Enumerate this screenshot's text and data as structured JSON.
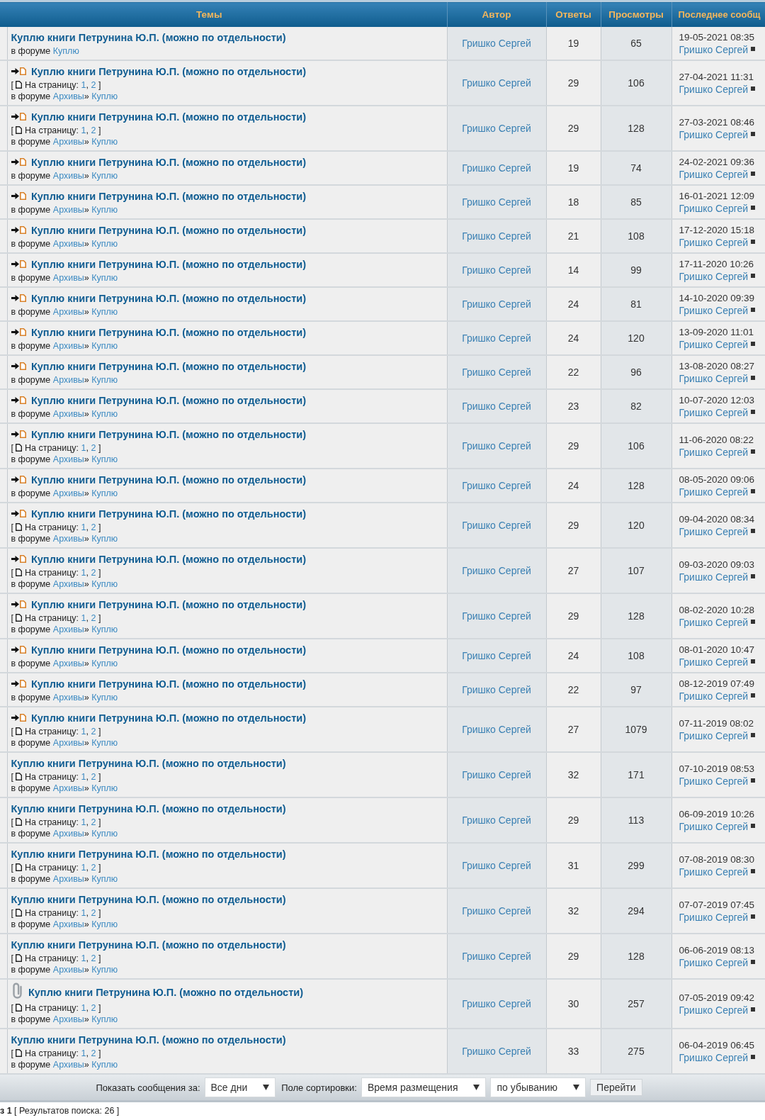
{
  "table": {
    "columns": [
      "Темы",
      "Автор",
      "Ответы",
      "Просмотры",
      "Последнее сообщ"
    ],
    "rows": [
      {
        "kind": "plain",
        "title": "Куплю книги Петрунина Ю.П. (можно по отдельности)",
        "forum": {
          "label": "в форуме",
          "links": [
            "Куплю"
          ]
        },
        "author": "Гришко Сергей",
        "replies": "19",
        "views": "65",
        "last_post": {
          "time": "19-05-2021 08:35",
          "author": "Гришко Сергей"
        }
      },
      {
        "kind": "moved",
        "title": "Куплю книги Петрунина Ю.П. (можно по отдельности)",
        "pages": {
          "open": "[",
          "label": "На страницу:",
          "links": [
            "1",
            "2"
          ],
          "separator": ",",
          "close": "]"
        },
        "forum": {
          "label": "в форуме",
          "links": [
            "Архивы",
            "Куплю"
          ],
          "separator": "»"
        },
        "author": "Гришко Сергей",
        "replies": "29",
        "views": "106",
        "last_post": {
          "time": "27-04-2021 11:31",
          "author": "Гришко Сергей"
        }
      },
      {
        "kind": "moved",
        "title": "Куплю книги Петрунина Ю.П. (можно по отдельности)",
        "pages": {
          "open": "[",
          "label": "На страницу:",
          "links": [
            "1",
            "2"
          ],
          "separator": ",",
          "close": "]"
        },
        "forum": {
          "label": "в форуме",
          "links": [
            "Архивы",
            "Куплю"
          ],
          "separator": "»"
        },
        "author": "Гришко Сергей",
        "replies": "29",
        "views": "128",
        "last_post": {
          "time": "27-03-2021 08:46",
          "author": "Гришко Сергей"
        }
      },
      {
        "kind": "moved",
        "title": "Куплю книги Петрунина Ю.П. (можно по отдельности)",
        "forum": {
          "label": "в форуме",
          "links": [
            "Архивы",
            "Куплю"
          ],
          "separator": "»"
        },
        "author": "Гришко Сергей",
        "replies": "19",
        "views": "74",
        "last_post": {
          "time": "24-02-2021 09:36",
          "author": "Гришко Сергей"
        }
      },
      {
        "kind": "moved",
        "title": "Куплю книги Петрунина Ю.П. (можно по отдельности)",
        "forum": {
          "label": "в форуме",
          "links": [
            "Архивы",
            "Куплю"
          ],
          "separator": "»"
        },
        "author": "Гришко Сергей",
        "replies": "18",
        "views": "85",
        "last_post": {
          "time": "16-01-2021 12:09",
          "author": "Гришко Сергей"
        }
      },
      {
        "kind": "moved",
        "title": "Куплю книги Петрунина Ю.П. (можно по отдельности)",
        "forum": {
          "label": "в форуме",
          "links": [
            "Архивы",
            "Куплю"
          ],
          "separator": "»"
        },
        "author": "Гришко Сергей",
        "replies": "21",
        "views": "108",
        "last_post": {
          "time": "17-12-2020 15:18",
          "author": "Гришко Сергей"
        }
      },
      {
        "kind": "moved",
        "title": "Куплю книги Петрунина Ю.П. (можно по отдельности)",
        "forum": {
          "label": "в форуме",
          "links": [
            "Архивы",
            "Куплю"
          ],
          "separator": "»"
        },
        "author": "Гришко Сергей",
        "replies": "14",
        "views": "99",
        "last_post": {
          "time": "17-11-2020 10:26",
          "author": "Гришко Сергей"
        }
      },
      {
        "kind": "moved",
        "title": "Куплю книги Петрунина Ю.П. (можно по отдельности)",
        "forum": {
          "label": "в форуме",
          "links": [
            "Архивы",
            "Куплю"
          ],
          "separator": "»"
        },
        "author": "Гришко Сергей",
        "replies": "24",
        "views": "81",
        "last_post": {
          "time": "14-10-2020 09:39",
          "author": "Гришко Сергей"
        }
      },
      {
        "kind": "moved",
        "title": "Куплю книги Петрунина Ю.П. (можно по отдельности)",
        "forum": {
          "label": "в форуме",
          "links": [
            "Архивы",
            "Куплю"
          ],
          "separator": "»"
        },
        "author": "Гришко Сергей",
        "replies": "24",
        "views": "120",
        "last_post": {
          "time": "13-09-2020 11:01",
          "author": "Гришко Сергей"
        }
      },
      {
        "kind": "moved",
        "title": "Куплю книги Петрунина Ю.П. (можно по отдельности)",
        "forum": {
          "label": "в форуме",
          "links": [
            "Архивы",
            "Куплю"
          ],
          "separator": "»"
        },
        "author": "Гришко Сергей",
        "replies": "22",
        "views": "96",
        "last_post": {
          "time": "13-08-2020 08:27",
          "author": "Гришко Сергей"
        }
      },
      {
        "kind": "moved",
        "title": "Куплю книги Петрунина Ю.П. (можно по отдельности)",
        "forum": {
          "label": "в форуме",
          "links": [
            "Архивы",
            "Куплю"
          ],
          "separator": "»"
        },
        "author": "Гришко Сергей",
        "replies": "23",
        "views": "82",
        "last_post": {
          "time": "10-07-2020 12:03",
          "author": "Гришко Сергей"
        }
      },
      {
        "kind": "moved",
        "title": "Куплю книги Петрунина Ю.П. (можно по отдельности)",
        "pages": {
          "open": "[",
          "label": "На страницу:",
          "links": [
            "1",
            "2"
          ],
          "separator": ",",
          "close": "]"
        },
        "forum": {
          "label": "в форуме",
          "links": [
            "Архивы",
            "Куплю"
          ],
          "separator": "»"
        },
        "author": "Гришко Сергей",
        "replies": "29",
        "views": "106",
        "last_post": {
          "time": "11-06-2020 08:22",
          "author": "Гришко Сергей"
        }
      },
      {
        "kind": "moved",
        "title": "Куплю книги Петрунина Ю.П. (можно по отдельности)",
        "forum": {
          "label": "в форуме",
          "links": [
            "Архивы",
            "Куплю"
          ],
          "separator": "»"
        },
        "author": "Гришко Сергей",
        "replies": "24",
        "views": "128",
        "last_post": {
          "time": "08-05-2020 09:06",
          "author": "Гришко Сергей"
        }
      },
      {
        "kind": "moved",
        "title": "Куплю книги Петрунина Ю.П. (можно по отдельности)",
        "pages": {
          "open": "[",
          "label": "На страницу:",
          "links": [
            "1",
            "2"
          ],
          "separator": ",",
          "close": "]"
        },
        "forum": {
          "label": "в форуме",
          "links": [
            "Архивы",
            "Куплю"
          ],
          "separator": "»"
        },
        "author": "Гришко Сергей",
        "replies": "29",
        "views": "120",
        "last_post": {
          "time": "09-04-2020 08:34",
          "author": "Гришко Сергей"
        }
      },
      {
        "kind": "moved",
        "title": "Куплю книги Петрунина Ю.П. (можно по отдельности)",
        "pages": {
          "open": "[",
          "label": "На страницу:",
          "links": [
            "1",
            "2"
          ],
          "separator": ",",
          "close": "]"
        },
        "forum": {
          "label": "в форуме",
          "links": [
            "Архивы",
            "Куплю"
          ],
          "separator": "»"
        },
        "author": "Гришко Сергей",
        "replies": "27",
        "views": "107",
        "last_post": {
          "time": "09-03-2020 09:03",
          "author": "Гришко Сергей"
        }
      },
      {
        "kind": "moved",
        "title": "Куплю книги Петрунина Ю.П. (можно по отдельности)",
        "pages": {
          "open": "[",
          "label": "На страницу:",
          "links": [
            "1",
            "2"
          ],
          "separator": ",",
          "close": "]"
        },
        "forum": {
          "label": "в форуме",
          "links": [
            "Архивы",
            "Куплю"
          ],
          "separator": "»"
        },
        "author": "Гришко Сергей",
        "replies": "29",
        "views": "128",
        "last_post": {
          "time": "08-02-2020 10:28",
          "author": "Гришко Сергей"
        }
      },
      {
        "kind": "moved",
        "title": "Куплю книги Петрунина Ю.П. (можно по отдельности)",
        "forum": {
          "label": "в форуме",
          "links": [
            "Архивы",
            "Куплю"
          ],
          "separator": "»"
        },
        "author": "Гришко Сергей",
        "replies": "24",
        "views": "108",
        "last_post": {
          "time": "08-01-2020 10:47",
          "author": "Гришко Сергей"
        }
      },
      {
        "kind": "moved",
        "title": "Куплю книги Петрунина Ю.П. (можно по отдельности)",
        "forum": {
          "label": "в форуме",
          "links": [
            "Архивы",
            "Куплю"
          ],
          "separator": "»"
        },
        "author": "Гришко Сергей",
        "replies": "22",
        "views": "97",
        "last_post": {
          "time": "08-12-2019 07:49",
          "author": "Гришко Сергей"
        }
      },
      {
        "kind": "moved",
        "title": "Куплю книги Петрунина Ю.П. (можно по отдельности)",
        "pages": {
          "open": "[",
          "label": "На страницу:",
          "links": [
            "1",
            "2"
          ],
          "separator": ",",
          "close": "]"
        },
        "forum": {
          "label": "в форуме",
          "links": [
            "Архивы",
            "Куплю"
          ],
          "separator": "»"
        },
        "author": "Гришко Сергей",
        "replies": "27",
        "views": "1079",
        "last_post": {
          "time": "07-11-2019 08:02",
          "author": "Гришко Сергей"
        }
      },
      {
        "kind": "plain",
        "title": "Куплю книги Петрунина Ю.П. (можно по отдельности)",
        "pages": {
          "open": "[",
          "label": "На страницу:",
          "links": [
            "1",
            "2"
          ],
          "separator": ",",
          "close": "]"
        },
        "forum": {
          "label": "в форуме",
          "links": [
            "Архивы",
            "Куплю"
          ],
          "separator": "»"
        },
        "author": "Гришко Сергей",
        "replies": "32",
        "views": "171",
        "last_post": {
          "time": "07-10-2019 08:53",
          "author": "Гришко Сергей"
        }
      },
      {
        "kind": "plain",
        "title": "Куплю книги Петрунина Ю.П. (можно по отдельности)",
        "pages": {
          "open": "[",
          "label": "На страницу:",
          "links": [
            "1",
            "2"
          ],
          "separator": ",",
          "close": "]"
        },
        "forum": {
          "label": "в форуме",
          "links": [
            "Архивы",
            "Куплю"
          ],
          "separator": "»"
        },
        "author": "Гришко Сергей",
        "replies": "29",
        "views": "113",
        "last_post": {
          "time": "06-09-2019 10:26",
          "author": "Гришко Сергей"
        }
      },
      {
        "kind": "plain",
        "title": "Куплю книги Петрунина Ю.П. (можно по отдельности)",
        "pages": {
          "open": "[",
          "label": "На страницу:",
          "links": [
            "1",
            "2"
          ],
          "separator": ",",
          "close": "]"
        },
        "forum": {
          "label": "в форуме",
          "links": [
            "Архивы",
            "Куплю"
          ],
          "separator": "»"
        },
        "author": "Гришко Сергей",
        "replies": "31",
        "views": "299",
        "last_post": {
          "time": "07-08-2019 08:30",
          "author": "Гришко Сергей"
        }
      },
      {
        "kind": "plain",
        "title": "Куплю книги Петрунина Ю.П. (можно по отдельности)",
        "pages": {
          "open": "[",
          "label": "На страницу:",
          "links": [
            "1",
            "2"
          ],
          "separator": ",",
          "close": "]"
        },
        "forum": {
          "label": "в форуме",
          "links": [
            "Архивы",
            "Куплю"
          ],
          "separator": "»"
        },
        "author": "Гришко Сергей",
        "replies": "32",
        "views": "294",
        "last_post": {
          "time": "07-07-2019 07:45",
          "author": "Гришко Сергей"
        }
      },
      {
        "kind": "plain",
        "title": "Куплю книги Петрунина Ю.П. (можно по отдельности)",
        "pages": {
          "open": "[",
          "label": "На страницу:",
          "links": [
            "1",
            "2"
          ],
          "separator": ",",
          "close": "]"
        },
        "forum": {
          "label": "в форуме",
          "links": [
            "Архивы",
            "Куплю"
          ],
          "separator": "»"
        },
        "author": "Гришко Сергей",
        "replies": "29",
        "views": "128",
        "last_post": {
          "time": "06-06-2019 08:13",
          "author": "Гришко Сергей"
        }
      },
      {
        "kind": "attachment",
        "title": "Куплю книги Петрунина Ю.П. (можно по отдельности)",
        "pages": {
          "open": "[",
          "label": "На страницу:",
          "links": [
            "1",
            "2"
          ],
          "separator": ",",
          "close": "]"
        },
        "forum": {
          "label": "в форуме",
          "links": [
            "Архивы",
            "Куплю"
          ],
          "separator": "»"
        },
        "author": "Гришко Сергей",
        "replies": "30",
        "views": "257",
        "last_post": {
          "time": "07-05-2019 09:42",
          "author": "Гришко Сергей"
        }
      },
      {
        "kind": "plain",
        "title": "Куплю книги Петрунина Ю.П. (можно по отдельности)",
        "pages": {
          "open": "[",
          "label": "На страницу:",
          "links": [
            "1",
            "2"
          ],
          "separator": ",",
          "close": "]"
        },
        "forum": {
          "label": "в форуме",
          "links": [
            "Архивы",
            "Куплю"
          ],
          "separator": "»"
        },
        "author": "Гришко Сергей",
        "replies": "33",
        "views": "275",
        "last_post": {
          "time": "06-04-2019 06:45",
          "author": "Гришко Сергей"
        }
      }
    ]
  },
  "sort_bar": {
    "items": [
      {
        "kind": "label",
        "text": "Показать сообщения за:"
      },
      {
        "kind": "select",
        "value": "Все дни"
      },
      {
        "kind": "label",
        "text": "Поле сортировки:"
      },
      {
        "kind": "select",
        "value": "Время размещения"
      },
      {
        "kind": "select",
        "value": "по убыванию"
      },
      {
        "kind": "button",
        "text": "Перейти"
      }
    ]
  },
  "status": "**з 1** [ Результатов поиска: 26 ]"
}
